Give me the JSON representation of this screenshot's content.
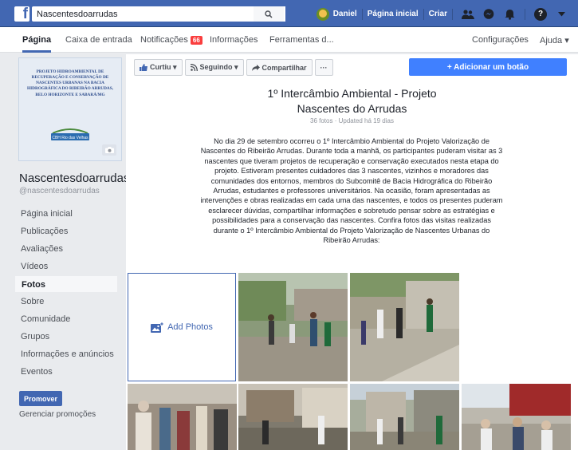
{
  "topbar": {
    "search_value": "Nascentesdoarrudas",
    "user_name": "Daniel",
    "home_label": "Página inicial",
    "create_label": "Criar",
    "brand_color": "#4267b2"
  },
  "nav": {
    "tabs": [
      {
        "label": "Página"
      },
      {
        "label": "Caixa de entrada"
      },
      {
        "label": "Notificações",
        "badge": "66"
      },
      {
        "label": "Informações"
      },
      {
        "label": "Ferramentas d..."
      }
    ],
    "settings_label": "Configurações",
    "help_label": "Ajuda ▾"
  },
  "sidebar": {
    "cover_text": "PROJETO HIDROAMBIENTAL DE RECUPERAÇÃO E CONSERVAÇÃO DE NASCENTES URBANAS NA BACIA HIDROGRÁFICA DO RIBEIRÃO ARRUDAS, BELO HORIZONTE E SABARÁ/MG",
    "cover_logo_text": "CBH Rio das Velhas",
    "page_name": "Nascentesdoarrudas",
    "page_handle": "@nascentesdoarrudas",
    "menu": [
      {
        "label": "Página inicial"
      },
      {
        "label": "Publicações"
      },
      {
        "label": "Avaliações"
      },
      {
        "label": "Vídeos"
      },
      {
        "label": "Fotos"
      },
      {
        "label": "Sobre"
      },
      {
        "label": "Comunidade"
      },
      {
        "label": "Grupos"
      },
      {
        "label": "Informações e anúncios"
      },
      {
        "label": "Eventos"
      }
    ],
    "active_item": "Fotos",
    "promote_label": "Promover",
    "manage_label": "Gerenciar promoções"
  },
  "actions": {
    "like_label": "Curtiu ▾",
    "follow_label": "Seguindo ▾",
    "share_label": "Compartilhar",
    "more_label": "···",
    "add_button_label": "+ Adicionar um botão"
  },
  "album": {
    "title_line1": "1º Intercâmbio Ambiental - Projeto",
    "title_line2": "Nascentes do Arrudas",
    "meta": "36 fotos · Updated há 19 dias",
    "description": "No dia 29 de setembro ocorreu o 1º Intercâmbio Ambiental do Projeto Valorização de Nascentes do Ribeirão Arrudas. Durante toda a manhã, os participantes puderam visitar as 3 nascentes que tiveram projetos de recuperação e conservação executados nesta etapa do projeto. Estiveram presentes cuidadores das 3 nascentes, vizinhos e moradores das comunidades dos entornos, membros do Subcomitê de Bacia Hidrográfica do Ribeirão Arrudas, estudantes e professores universitários. Na ocasião, foram apresentadas as intervenções e obras realizadas em cada uma das nascentes, e todos os presentes puderam esclarecer dúvidas, compartilhar informações e sobretudo pensar sobre as estratégias e possibilidades para a conservação das nascentes. Confira fotos das visitas realizadas durante o 1º Intercâmbio Ambiental do Projeto Valorização de Nascentes Urbanas do Ribeirão Arrudas:",
    "add_photos_label": "Add Photos"
  }
}
